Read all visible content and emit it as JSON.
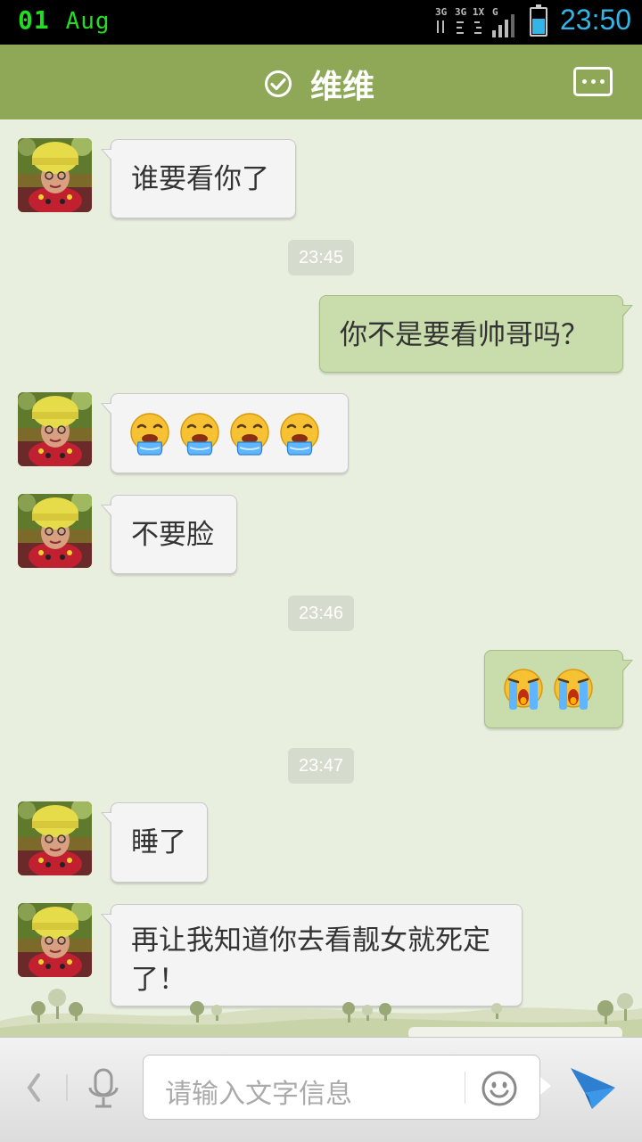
{
  "status_bar": {
    "date_day": "01",
    "date_month": "Aug",
    "time": "23:50",
    "network_labels": [
      "3G",
      "3G 1X",
      "G"
    ],
    "time_color": "#33b5e5",
    "date_color": "#22dd22"
  },
  "header": {
    "title": "维维",
    "verified_icon": "check-circle-icon",
    "menu_icon": "more-dots-icon",
    "bg_color": "#8fa858"
  },
  "messages": [
    {
      "side": "in",
      "type": "text",
      "text": "谁要看你了"
    },
    {
      "type": "time",
      "text": "23:45"
    },
    {
      "side": "out",
      "type": "text",
      "text": "你不是要看帅哥吗？"
    },
    {
      "side": "in",
      "type": "emoji",
      "emoji": "drooling-face-emoji",
      "count": 4
    },
    {
      "side": "in",
      "type": "text",
      "text": "不要脸"
    },
    {
      "type": "time",
      "text": "23:46"
    },
    {
      "side": "out",
      "type": "emoji",
      "emoji": "crying-face-emoji",
      "count": 2
    },
    {
      "type": "time",
      "text": "23:47"
    },
    {
      "side": "in",
      "type": "text",
      "text": "睡了"
    },
    {
      "side": "in",
      "type": "text",
      "text": "再让我知道你去看靓女就死定了！"
    }
  ],
  "input_bar": {
    "placeholder": "请输入文字信息",
    "back_icon": "chevron-left-icon",
    "voice_icon": "microphone-icon",
    "emoji_icon": "smiley-icon",
    "send_icon": "send-plane-icon"
  }
}
